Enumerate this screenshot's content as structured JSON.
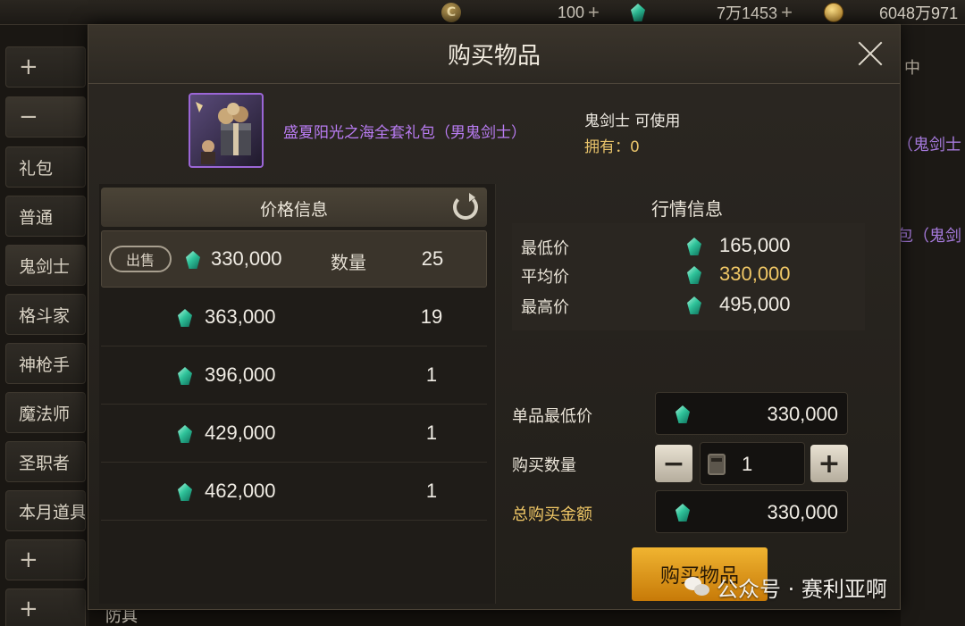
{
  "topbar": {
    "currency1": "100",
    "currency2": "7万1453",
    "currency3": "6048万971"
  },
  "sidebar": {
    "items": [
      "礼包",
      "普通",
      "鬼剑士",
      "格斗家",
      "神枪手",
      "魔法师",
      "圣职者",
      "本月道具"
    ],
    "bottom_label": "防具"
  },
  "background": {
    "right_col_header": "中",
    "right_text_1": "（鬼剑士",
    "right_text_2": "包（鬼剑"
  },
  "dialog": {
    "title": "购买物品",
    "item": {
      "name": "盛夏阳光之海全套礼包（男鬼剑士）",
      "usable": "鬼剑士 可使用",
      "owned_label": "拥有：",
      "owned_count": "0"
    },
    "price_panel": {
      "header": "价格信息",
      "sell_label": "出售",
      "qty_label": "数量",
      "rows": [
        {
          "price": "330,000",
          "qty": "25"
        },
        {
          "price": "363,000",
          "qty": "19"
        },
        {
          "price": "396,000",
          "qty": "1"
        },
        {
          "price": "429,000",
          "qty": "1"
        },
        {
          "price": "462,000",
          "qty": "1"
        }
      ]
    },
    "market": {
      "title": "行情信息",
      "min_label": "最低价",
      "min_value": "165,000",
      "avg_label": "平均价",
      "avg_value": "330,000",
      "max_label": "最高价",
      "max_value": "495,000"
    },
    "form": {
      "unit_min_label": "单品最低价",
      "unit_min_value": "330,000",
      "qty_label": "购买数量",
      "qty_value": "1",
      "total_label": "总购买金额",
      "total_value": "330,000"
    },
    "buy_button": "购买物品"
  },
  "watermark": "公众号 · 赛利亚啊",
  "colors": {
    "accent_gold": "#f0c766",
    "item_purple": "#b97cf2",
    "buy_button": "#e89a18"
  }
}
